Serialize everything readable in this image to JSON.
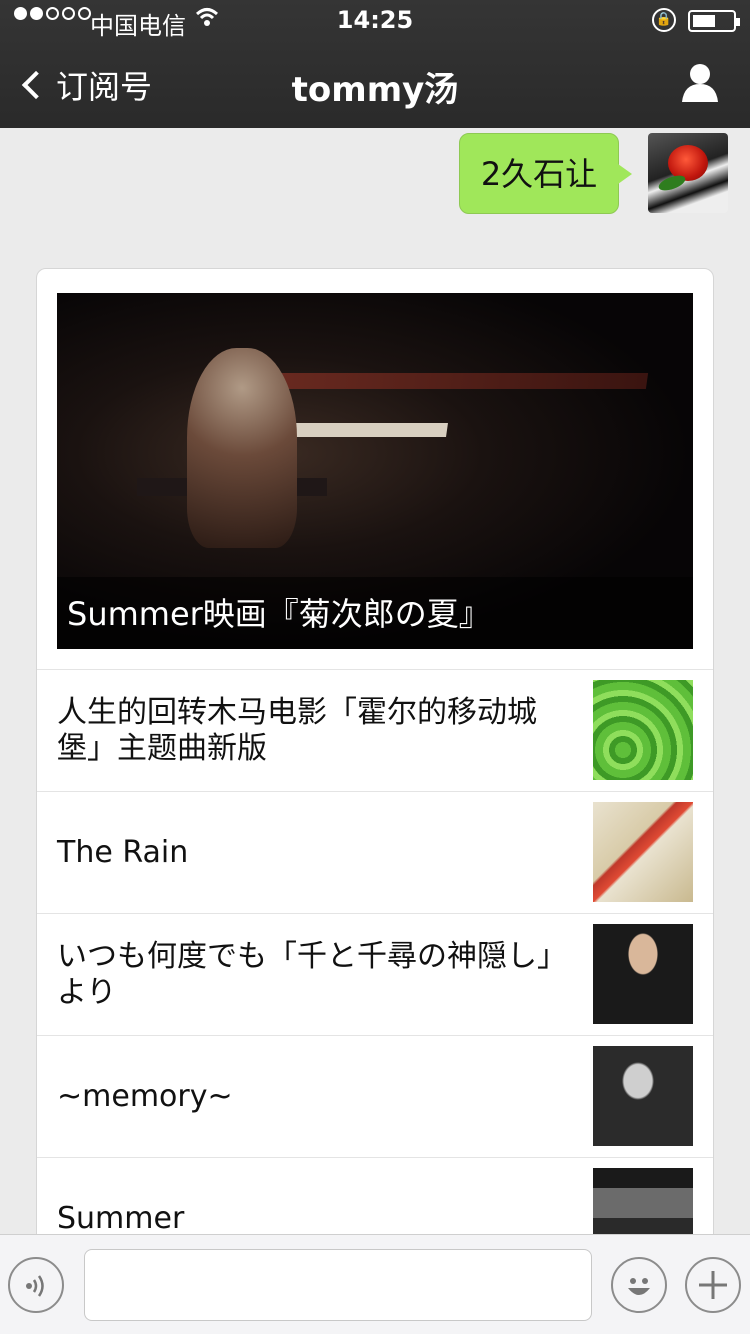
{
  "status_bar": {
    "carrier": "中国电信",
    "time": "14:25"
  },
  "nav": {
    "back_label": "订阅号",
    "title": "tommy汤"
  },
  "chat": {
    "sent_message": "2久石让"
  },
  "article_card": {
    "cover_caption": "Summer映画『菊次郎の夏』",
    "items": [
      {
        "title": "人生的回转木马电影「霍尔的移动城堡」主题曲新版"
      },
      {
        "title": "The Rain"
      },
      {
        "title": "いつも何度でも「千と千尋の神隠し」より"
      },
      {
        "title": "~memory~"
      },
      {
        "title": "Summer"
      }
    ]
  },
  "colors": {
    "nav_bg": "#2f2f2f",
    "bubble_green": "#a0e75a",
    "background": "#ebebeb"
  },
  "icons": {
    "signal": "signal-dots-icon",
    "wifi": "wifi-icon",
    "lock": "rotation-lock-icon",
    "battery": "battery-icon",
    "back": "chevron-left-icon",
    "profile": "person-icon",
    "voice": "voice-icon",
    "emoji": "emoji-icon",
    "add": "plus-icon"
  }
}
